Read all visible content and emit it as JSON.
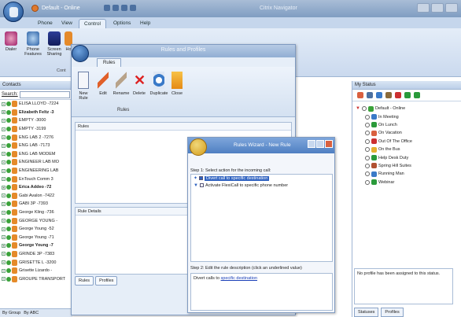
{
  "app": {
    "title": "Citrix Navigator",
    "quick_profile": "Default - Online",
    "colors": {
      "ribbon_bg": "#d4e1f1",
      "accent": "#2f62c0",
      "online": "#3aa23a"
    }
  },
  "main_tabs": [
    "Phone",
    "View",
    "Control",
    "Options",
    "Help"
  ],
  "ribbon": {
    "buttons": [
      "Dialer",
      "Phone Features",
      "Screen Sharing",
      "Ho"
    ],
    "group_label": "Cont"
  },
  "contacts": {
    "header": "Contacts",
    "search_label": "Search:",
    "items": [
      {
        "name": "ELISA LLOYD -7224",
        "bold": false
      },
      {
        "name": "Elizabeth Feltz -3",
        "bold": true
      },
      {
        "name": "EMPTY -3000",
        "bold": false
      },
      {
        "name": "EMPTY -3199",
        "bold": false
      },
      {
        "name": "ENG LAB 2 -7276",
        "bold": false
      },
      {
        "name": "ENG LAB -7173",
        "bold": false
      },
      {
        "name": "ENG LAB MODEM",
        "bold": false
      },
      {
        "name": "ENGINEER LAB MO",
        "bold": false
      },
      {
        "name": "ENGINEERING LAB",
        "bold": false
      },
      {
        "name": "EnTouch Comm 3",
        "bold": false
      },
      {
        "name": "Erica Addeo -72",
        "bold": true
      },
      {
        "name": "Gabi Avalon -7422",
        "bold": false
      },
      {
        "name": "GABI 3P -7393",
        "bold": false
      },
      {
        "name": "George Kling -736",
        "bold": false
      },
      {
        "name": "GEORGE YOUNG -",
        "bold": false
      },
      {
        "name": "George Young -52",
        "bold": false
      },
      {
        "name": "George Young -71",
        "bold": false
      },
      {
        "name": "George Young -7",
        "bold": true
      },
      {
        "name": "GRINDE 3P -7383",
        "bold": false
      },
      {
        "name": "GRISETTE L -3200",
        "bold": false
      },
      {
        "name": "Grisette Lizardo -",
        "bold": false
      },
      {
        "name": "GROUPE TRANSPORT",
        "bold": false
      }
    ],
    "bottom_tabs": [
      "By Group",
      "By ABC"
    ]
  },
  "rules_profiles": {
    "title": "Rules and Profiles",
    "tab": "Rules",
    "buttons": [
      "New Rule",
      "Edit",
      "Rename",
      "Delete",
      "Duplicate",
      "Close"
    ],
    "group_label": "Rules",
    "rules_header": "Rules",
    "details_header": "Rule Details",
    "bottom_tabs": [
      "Rules",
      "Profiles"
    ]
  },
  "wizard": {
    "title": "Rules Wizard - New Rule",
    "step1": "Step 1: Select action for the incoming call:",
    "options": [
      {
        "label": "Divert call to specific destination",
        "selected": true
      },
      {
        "label": "Activate FlexiCall to specific phone number",
        "selected": false
      }
    ],
    "step2": "Step 2: Edit the rule description (click an underlined value)",
    "description_prefix": "Divert calls to",
    "description_link": "specific destination"
  },
  "my_status": {
    "header": "My Status",
    "root": "Default - Online",
    "items": [
      "In Meeting",
      "On Lunch",
      "On Vacation",
      "Out Of The Office",
      "On the Bus",
      "Help Desk Duty",
      "Spring Hill Suites",
      "Running Man",
      "Webinar"
    ],
    "message": "No profile has been assigned to this status.",
    "tabs": [
      "Statuses",
      "Profiles"
    ]
  }
}
